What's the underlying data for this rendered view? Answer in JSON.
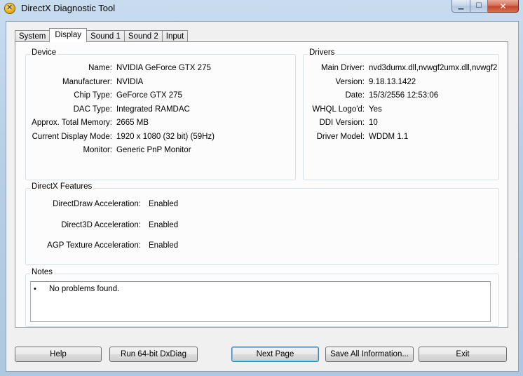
{
  "window": {
    "title": "DirectX Diagnostic Tool"
  },
  "tabs": [
    {
      "label": "System"
    },
    {
      "label": "Display"
    },
    {
      "label": "Sound 1"
    },
    {
      "label": "Sound 2"
    },
    {
      "label": "Input"
    }
  ],
  "active_tab": "Display",
  "device": {
    "title": "Device",
    "fields": [
      {
        "label": "Name:",
        "value": "NVIDIA GeForce GTX 275"
      },
      {
        "label": "Manufacturer:",
        "value": "NVIDIA"
      },
      {
        "label": "Chip Type:",
        "value": "GeForce GTX 275"
      },
      {
        "label": "DAC Type:",
        "value": "Integrated RAMDAC"
      },
      {
        "label": "Approx. Total Memory:",
        "value": "2665 MB"
      },
      {
        "label": "Current Display Mode:",
        "value": "1920 x 1080 (32 bit) (59Hz)"
      },
      {
        "label": "Monitor:",
        "value": "Generic PnP Monitor"
      }
    ]
  },
  "drivers": {
    "title": "Drivers",
    "fields": [
      {
        "label": "Main Driver:",
        "value": "nvd3dumx.dll,nvwgf2umx.dll,nvwgf2"
      },
      {
        "label": "Version:",
        "value": "9.18.13.1422"
      },
      {
        "label": "Date:",
        "value": "15/3/2556 12:53:06"
      },
      {
        "label": "WHQL Logo'd:",
        "value": "Yes"
      },
      {
        "label": "DDI Version:",
        "value": "10"
      },
      {
        "label": "Driver Model:",
        "value": "WDDM 1.1"
      }
    ]
  },
  "features": {
    "title": "DirectX Features",
    "fields": [
      {
        "label": "DirectDraw Acceleration:",
        "value": "Enabled"
      },
      {
        "label": "Direct3D Acceleration:",
        "value": "Enabled"
      },
      {
        "label": "AGP Texture Acceleration:",
        "value": "Enabled"
      }
    ]
  },
  "notes": {
    "title": "Notes",
    "bullet": "•",
    "items": [
      "No problems found."
    ]
  },
  "buttons": {
    "help": "Help",
    "run64": "Run 64-bit DxDiag",
    "next_page": "Next Page",
    "save_all": "Save All Information...",
    "exit": "Exit"
  }
}
